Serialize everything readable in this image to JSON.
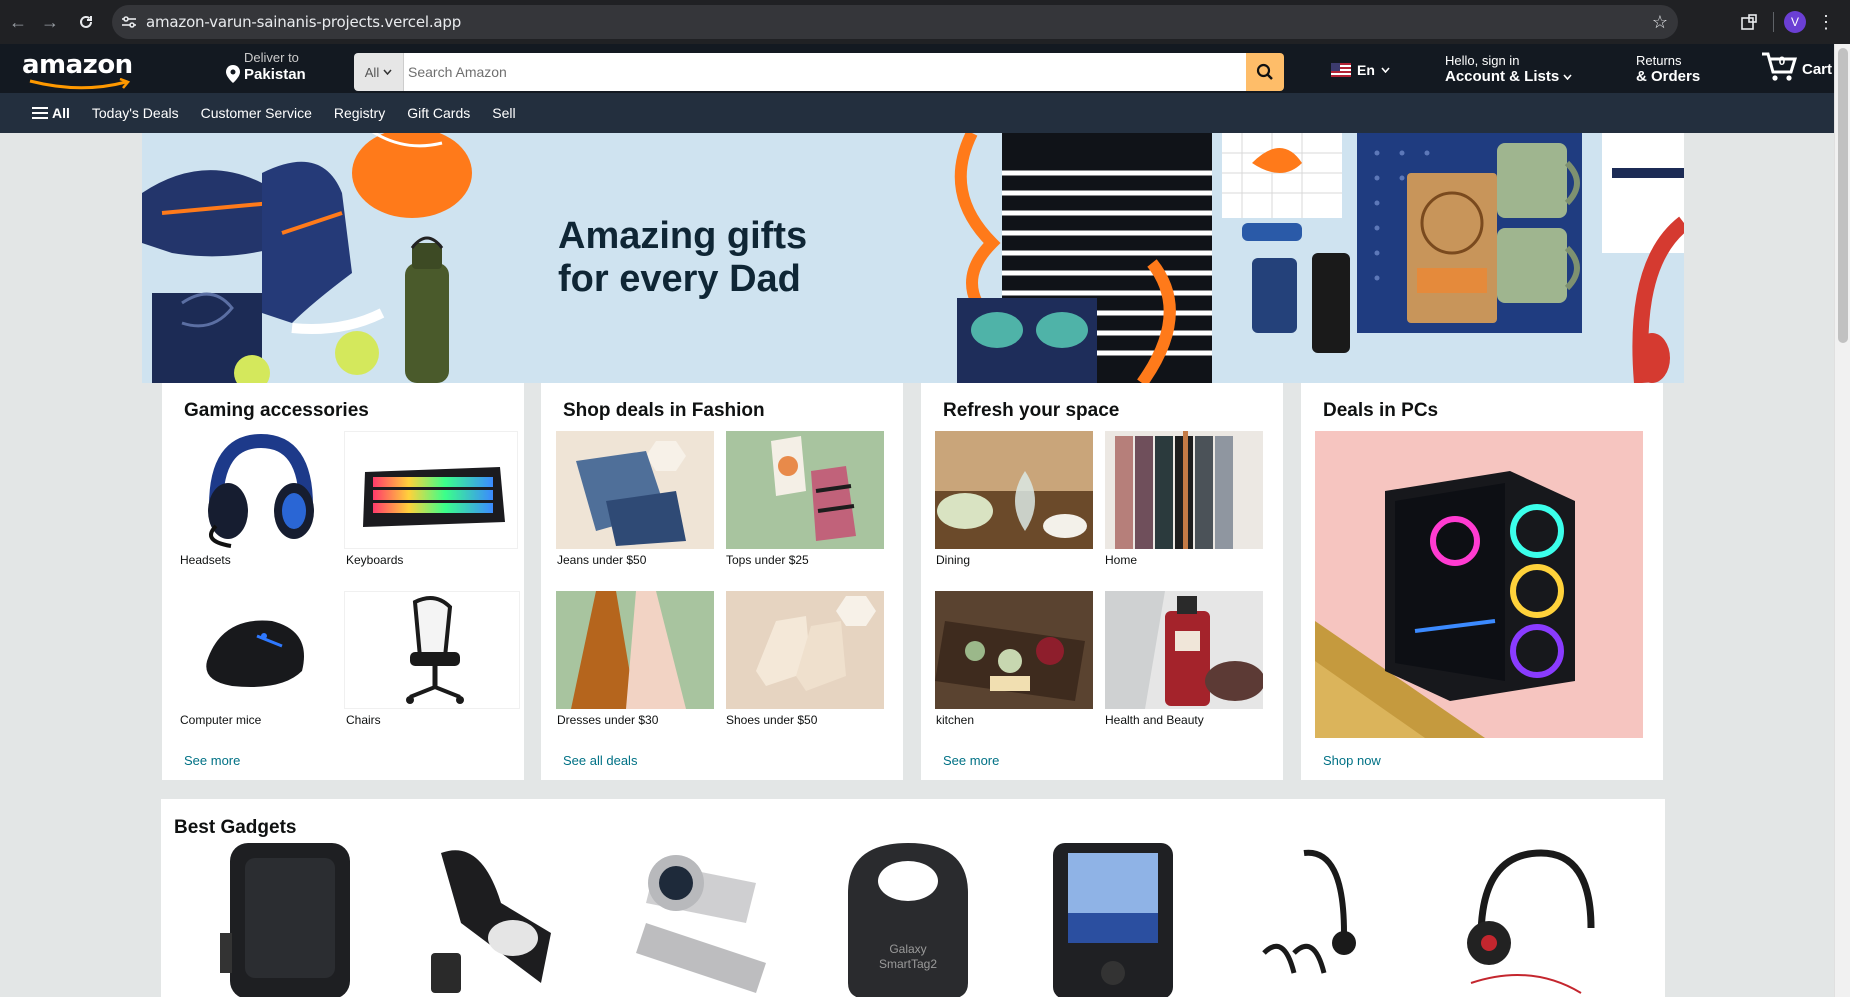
{
  "browser": {
    "url": "amazon-varun-sainanis-projects.vercel.app",
    "avatar_letter": "V"
  },
  "header": {
    "logo": "amazon",
    "deliver_small": "Deliver to",
    "deliver_big": "Pakistan",
    "search_category": "All",
    "search_placeholder": "Search Amazon",
    "language": "En",
    "account_small": "Hello, sign in",
    "account_big": "Account & Lists",
    "returns_small": "Returns",
    "returns_big": "& Orders",
    "cart_label": "Cart",
    "cart_count": "0"
  },
  "subnav": {
    "all_label": "All",
    "items": [
      "Today's Deals",
      "Customer Service",
      "Registry",
      "Gift Cards",
      "Sell"
    ]
  },
  "hero": {
    "title_line1": "Amazing gifts",
    "title_line2": "for every Dad"
  },
  "cards": [
    {
      "title": "Gaming accessories",
      "items": [
        "Headsets",
        "Keyboards",
        "Computer mice",
        "Chairs"
      ],
      "link": "See more"
    },
    {
      "title": "Shop deals in Fashion",
      "items": [
        "Jeans under $50",
        "Tops under $25",
        "Dresses under $30",
        "Shoes under $50"
      ],
      "link": "See all deals"
    },
    {
      "title": "Refresh your space",
      "items": [
        "Dining",
        "Home",
        "kitchen",
        "Health and Beauty"
      ],
      "link": "See more"
    },
    {
      "title": "Deals in PCs",
      "link": "Shop now"
    }
  ],
  "gadgets": {
    "title": "Best Gadgets"
  },
  "colors": {
    "header_bg": "#131921",
    "subnav_bg": "#232f3e",
    "search_btn": "#febd69",
    "link": "#007185",
    "page_bg": "#e3e6e6"
  }
}
